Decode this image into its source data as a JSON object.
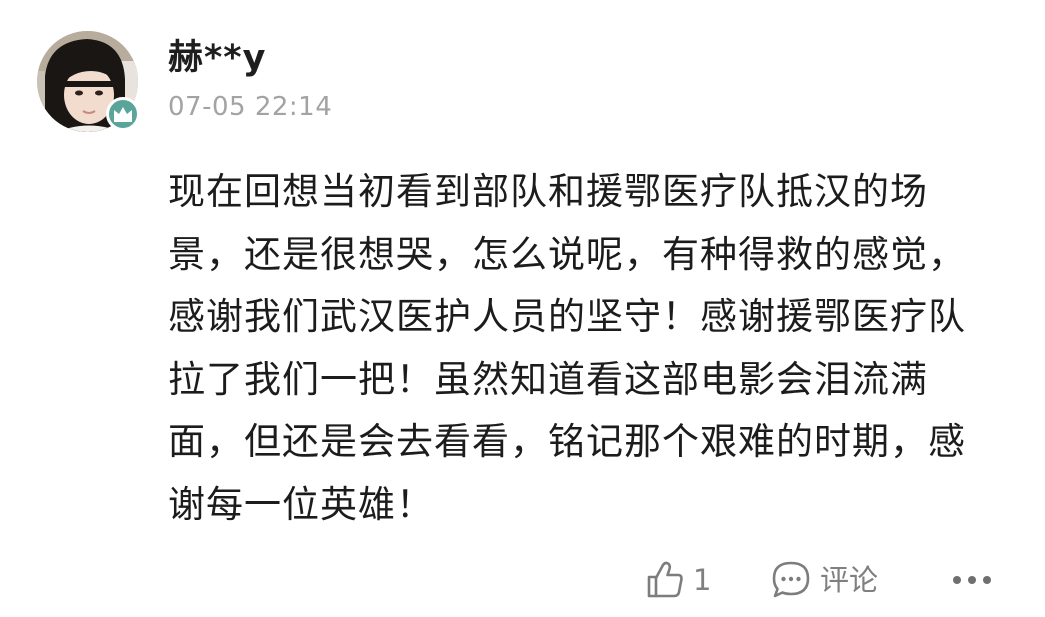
{
  "post": {
    "username": "赫**y",
    "timestamp": "07-05 22:14",
    "content_lines": [
      "现在回想当初看到部队和援鄂医疗队抵汉的场",
      "景，还是很想哭，怎么说呢，有种得救的感觉，",
      "感谢我们武汉医护人员的坚守！感谢援鄂医疗队",
      "拉了我们一把！虽然知道看这部电影会泪流满",
      "面，但还是会去看看，铭记那个艰难的时期，感",
      "谢每一位英雄！"
    ]
  },
  "actions": {
    "like_count": "1",
    "comment_label": "评论"
  },
  "icons": {
    "avatar_badge": "crown-icon",
    "like": "thumbs-up-icon",
    "comment": "speech-bubble-icon",
    "more": "more-dots-icon"
  },
  "colors": {
    "badge": "#5aa59a",
    "username": "#1e1e1e",
    "timestamp": "#a3a3a3",
    "content": "#1c1c1c",
    "action": "#808080"
  }
}
